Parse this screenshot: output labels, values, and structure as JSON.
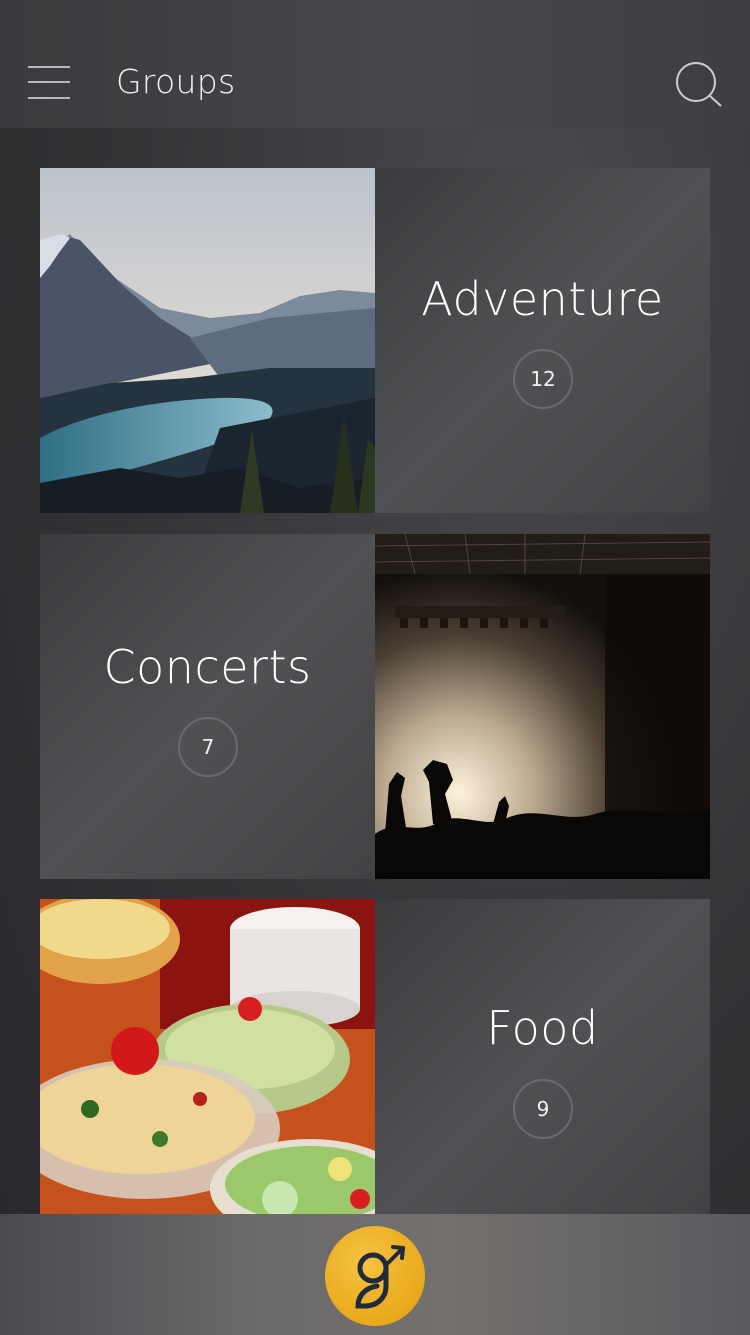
{
  "header": {
    "title": "Groups",
    "menu_icon": "hamburger-menu-icon",
    "search_icon": "search-icon"
  },
  "groups": [
    {
      "name": "Adventure",
      "count": "12",
      "image": "mountain-lake-photo",
      "layout": "image-left"
    },
    {
      "name": "Concerts",
      "count": "7",
      "image": "concert-crowd-photo",
      "layout": "image-right"
    },
    {
      "name": "Food",
      "count": "9",
      "image": "buffet-salads-photo",
      "layout": "image-left"
    }
  ],
  "bottom_bar": {
    "home_icon": "app-logo-icon",
    "accent_color": "#EFB52C"
  }
}
